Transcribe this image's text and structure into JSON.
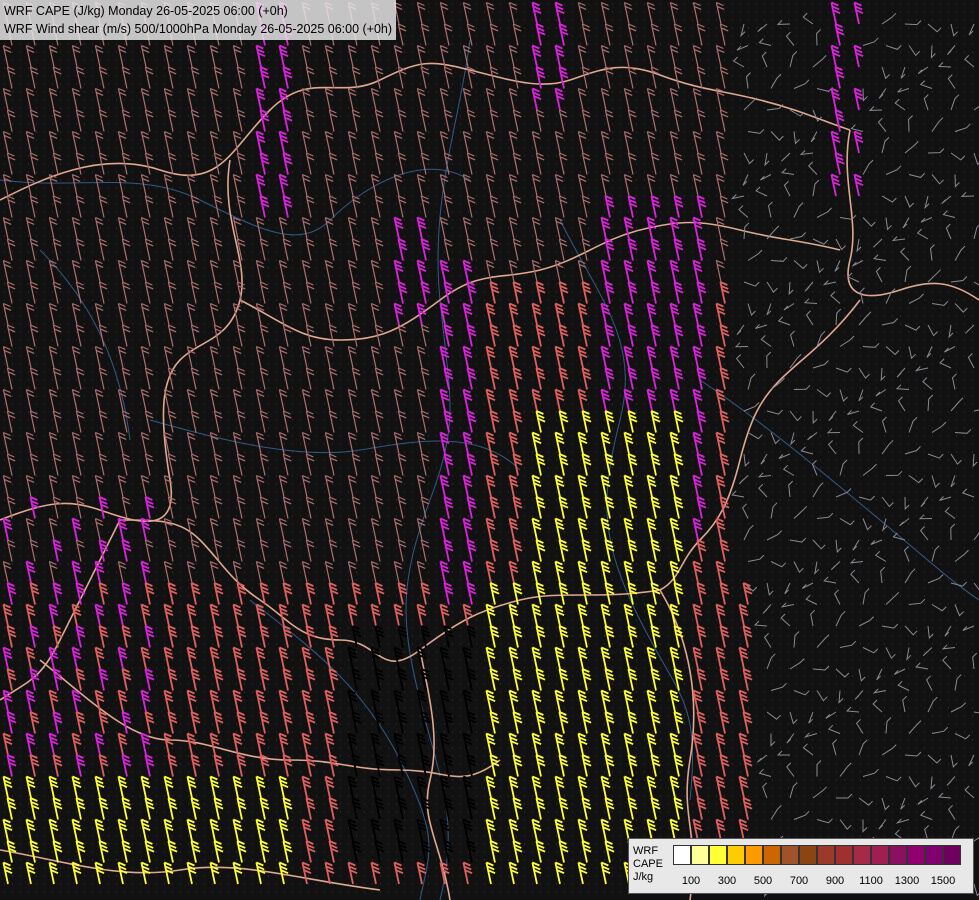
{
  "title": {
    "line1": "WRF CAPE (J/kg) Monday 26-05-2025 06:00 (+0h)",
    "line2": "WRF Wind shear (m/s) 500/1000hPa Monday 26-05-2025 06:00 (+0h)"
  },
  "legend": {
    "name_line1": "WRF",
    "name_line2": "CAPE",
    "name_line3": "J/kg",
    "colors": [
      "#ffffff",
      "#ffff99",
      "#ffff33",
      "#ffcc00",
      "#ff9900",
      "#cc6600",
      "#a0522d",
      "#8b4513",
      "#9b3a2a",
      "#a03030",
      "#a52a45",
      "#a01e50",
      "#8b1060",
      "#900070",
      "#800070",
      "#700060"
    ],
    "tick_labels": [
      "100",
      "300",
      "500",
      "700",
      "900",
      "1100",
      "1300",
      "1500"
    ]
  },
  "map": {
    "background": "#111111",
    "border_color": "#e0a890",
    "river_color": "#3a6ea5",
    "barb_colors": {
      "weak": "#8a8a95",
      "light": "#b07070",
      "moderate": "#e06060",
      "strong": "#dd22dd",
      "cape": "#ffff33",
      "dark": "#000000"
    }
  }
}
